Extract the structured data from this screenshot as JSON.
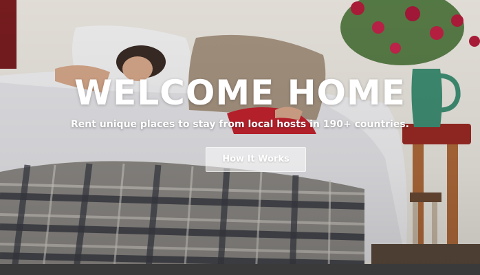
{
  "hero": {
    "headline": "WELCOME HOME",
    "subheadline": "Rent unique places to stay from local hosts in 190+ countries.",
    "cta_label": "How It Works"
  },
  "colors": {
    "headline_text": "#ffffff",
    "cta_background": "rgba(255,255,255,0.52)",
    "bottom_strip": "#3a3a3a"
  }
}
